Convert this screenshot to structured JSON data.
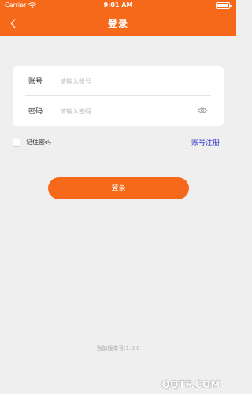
{
  "status_bar": {
    "carrier": "Carrier",
    "wifi_icon": "wifi-icon",
    "time": "9:01 AM",
    "battery_icon": "battery-icon"
  },
  "nav": {
    "back_icon": "chevron-left-icon",
    "title": "登录"
  },
  "form": {
    "account": {
      "label": "账号",
      "placeholder": "请输入账号",
      "value": ""
    },
    "password": {
      "label": "密码",
      "placeholder": "请输入密码",
      "value": "",
      "toggle_icon": "eye-icon"
    }
  },
  "remember": {
    "label": "记住密码",
    "checked": false
  },
  "register_link": "账号注册",
  "login_button": "登录",
  "version": "当前版本号:1.0.0",
  "watermark": "QQTF.COM",
  "colors": {
    "brand": "#f6691b",
    "link": "#3033c5",
    "background": "#efefef"
  }
}
